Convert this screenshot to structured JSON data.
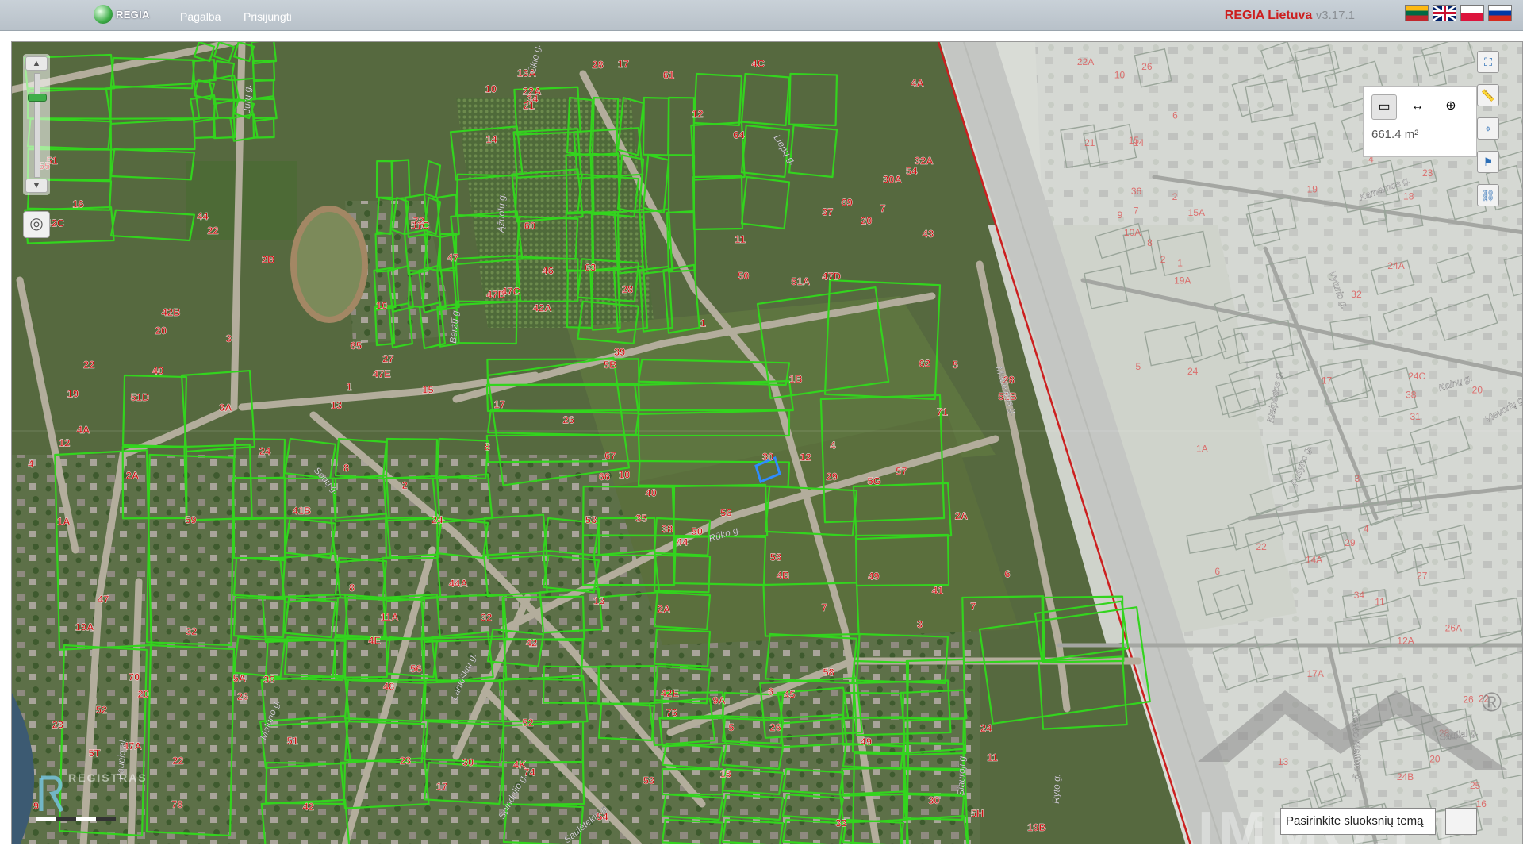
{
  "app": {
    "logo_text": "REGIA",
    "nav": [
      "Pagalba",
      "Prisijungti"
    ],
    "brand_name": "REGIA Lietuva",
    "version": "v3.17.1",
    "languages": [
      "lt",
      "en",
      "pl",
      "ru"
    ]
  },
  "measure": {
    "value": "661.4 m²",
    "tools": [
      "area-measure",
      "distance-measure",
      "location-measure"
    ]
  },
  "map": {
    "streets": [
      "Jurų g.",
      "Ūkio g.",
      "Liepų g.",
      "Ąžuolų g.",
      "Beržų g.",
      "Sodų g.",
      "Rūko g.",
      "Medeinos g.",
      "Lankiškių g.",
      "Spindulio g.",
      "Saulėtekio g.",
      "Ryto g.",
      "Siauroji g.",
      "Pušyno g.",
      "Kalnų g.",
      "Kamarnos g.",
      "Vyturio g.",
      "Klaipėdos g.",
      "Vievorių g.",
      "Sauliai g.",
      "Klauso Malūno g.",
      "Malūno g.",
      "Paupio al."
    ],
    "lot_labels": [
      "23",
      "2A",
      "1",
      "3",
      "4",
      "4A",
      "11A",
      "13A",
      "11",
      "12",
      "10",
      "9A",
      "8",
      "7",
      "6",
      "5",
      "2A",
      "17",
      "32",
      "8",
      "10",
      "12",
      "14",
      "16",
      "13",
      "20",
      "22",
      "5T",
      "5G",
      "5H",
      "7",
      "30",
      "30A",
      "28",
      "22A",
      "24",
      "26",
      "2",
      "4",
      "6",
      "8",
      "10",
      "12",
      "27",
      "29",
      "32A",
      "36",
      "41B",
      "44A",
      "42A",
      "40",
      "42",
      "20",
      "22",
      "24",
      "26",
      "28",
      "30",
      "32",
      "34",
      "17",
      "51B",
      "51C",
      "51D",
      "51A",
      "51",
      "53",
      "49",
      "47",
      "60",
      "58",
      "56",
      "54",
      "52",
      "50",
      "1",
      "33",
      "35",
      "37",
      "39",
      "41",
      "43",
      "45",
      "47",
      "49",
      "51",
      "53",
      "55",
      "57",
      "59",
      "61",
      "63",
      "65",
      "67",
      "69",
      "71",
      "74",
      "76",
      "78",
      "70",
      "72",
      "66",
      "64",
      "62",
      "58",
      "56",
      "54",
      "52",
      "50",
      "48",
      "46",
      "44",
      "28",
      "30",
      "26",
      "24",
      "22",
      "20",
      "18",
      "23",
      "21",
      "19",
      "17",
      "15",
      "13",
      "11",
      "9",
      "7",
      "5",
      "3",
      "19A",
      "19B",
      "3A",
      "5B",
      "5A",
      "1B",
      "1A",
      "2B",
      "2A",
      "4A",
      "4B",
      "4C",
      "4E",
      "4K",
      "42B",
      "42C",
      "42E",
      "47A",
      "47B",
      "47C",
      "47D",
      "47E",
      "44",
      "42",
      "40",
      "38"
    ],
    "right_labels": [
      "24A",
      "24B",
      "24C",
      "26",
      "28",
      "24",
      "22A",
      "22",
      "20",
      "17A",
      "14",
      "16",
      "18",
      "20",
      "22",
      "26",
      "32",
      "34",
      "36",
      "38",
      "10",
      "8",
      "6",
      "4",
      "2",
      "21",
      "19",
      "17",
      "15",
      "13",
      "11",
      "9",
      "7",
      "5",
      "3",
      "1",
      "15A",
      "14A",
      "12A",
      "10A",
      "26A",
      "25",
      "27",
      "29",
      "31",
      "23",
      "19A",
      "1A",
      "6",
      "2",
      "4"
    ]
  },
  "watermark": {
    "text": "IMMO.LT",
    "registras": "REGISTRAS"
  },
  "theme_selector": {
    "label": "Pasirinkite sluoksnių temą"
  },
  "colors": {
    "parcel_line": "#33d41e",
    "lot_label": "#cc1111",
    "highlight": "#2f8cff",
    "boundary": "#cc1f1f"
  }
}
